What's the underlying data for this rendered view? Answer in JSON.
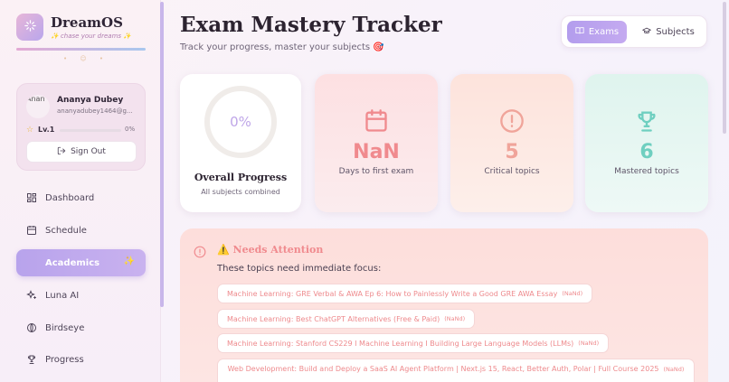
{
  "brand": {
    "name": "DreamOS",
    "tagline": "✨ chase your dreams ✨",
    "dots": "• ☺ •"
  },
  "user": {
    "avatar_alt": "Anan",
    "name": "Ananya Dubey",
    "email": "ananyadubey1464@g...",
    "level": "Lv.1",
    "level_progress": 0,
    "level_percent": "0%",
    "sign_out": "Sign Out"
  },
  "nav": [
    {
      "label": "Dashboard",
      "icon": "dashboard-icon"
    },
    {
      "label": "Schedule",
      "icon": "calendar-icon"
    },
    {
      "label": "Academics",
      "icon": "graduation-cap-icon",
      "active": true
    },
    {
      "label": "Luna AI",
      "icon": "sparkles-icon"
    },
    {
      "label": "Birdseye",
      "icon": "globe-icon"
    },
    {
      "label": "Progress",
      "icon": "trophy-icon"
    }
  ],
  "header": {
    "title": "Exam Mastery Tracker",
    "subtitle": "Track your progress, master your subjects",
    "subtitle_emoji": "🎯"
  },
  "view_toggle": {
    "exams": "Exams",
    "subjects": "Subjects",
    "active": "exams"
  },
  "overall": {
    "percent": "0%",
    "title": "Overall Progress",
    "subtitle": "All subjects combined"
  },
  "stats": {
    "days": {
      "value": "NaN",
      "label": "Days to first exam",
      "color": "#f08a8e"
    },
    "critical": {
      "value": "5",
      "label": "Critical topics",
      "color": "#f0a49a"
    },
    "mastered": {
      "value": "6",
      "label": "Mastered topics",
      "color": "#6fcfc0"
    }
  },
  "attention": {
    "title": "⚠️ Needs Attention",
    "subtitle": "These topics need immediate focus:",
    "topics": [
      {
        "text": "Machine Learning: GRE Verbal & AWA Ep 6: How to Painlessly Write a Good GRE AWA Essay",
        "tag": "(NaNd)"
      },
      {
        "text": "Machine Learning: Best ChatGPT Alternatives (Free & Paid)",
        "tag": "(NaNd)"
      },
      {
        "text": "Machine Learning: Stanford CS229 I Machine Learning I Building Large Language Models (LLMs)",
        "tag": "(NaNd)"
      },
      {
        "text": "Web Development: Build and Deploy a SaaS AI Agent Platform | Next.js 15, React, Better Auth, Polar | Full Course 2025",
        "tag": "(NaNd)"
      }
    ]
  }
}
